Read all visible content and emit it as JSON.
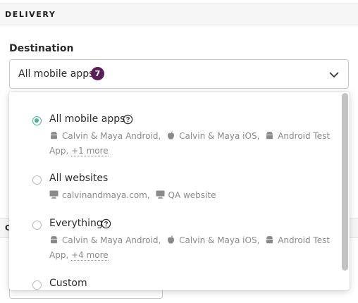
{
  "section": {
    "title": "DELIVERY"
  },
  "destination": {
    "label": "Destination",
    "selected": "All mobile apps",
    "count": "7"
  },
  "background": {
    "section2_letter": "C"
  },
  "options": [
    {
      "title": "All mobile apps",
      "selected": true,
      "line1": {
        "a": "Calvin & Maya Android,",
        "b": "Calvin & Maya iOS,",
        "c": "Android Test"
      },
      "line2": {
        "text": "App,",
        "more": "+1 more"
      }
    },
    {
      "title": "All websites",
      "selected": false,
      "line1": {
        "a": "calvinandmaya.com,",
        "b": "QA website"
      }
    },
    {
      "title": "Everything",
      "selected": false,
      "line1": {
        "a": "Calvin & Maya Android,",
        "b": "Calvin & Maya iOS,",
        "c": "Android Test"
      },
      "line2": {
        "text": "App,",
        "more": "+4 more"
      }
    },
    {
      "title": "Custom",
      "selected": false
    }
  ],
  "icons": {
    "android": "android-icon",
    "apple": "apple-icon",
    "monitor": "monitor-icon",
    "help": "help-circle-icon",
    "chevron": "chevron-down-icon"
  },
  "colors": {
    "badge": "#5a1e5b",
    "radio_selected": "#3fb78f",
    "muted_text": "#8a8a8a"
  }
}
